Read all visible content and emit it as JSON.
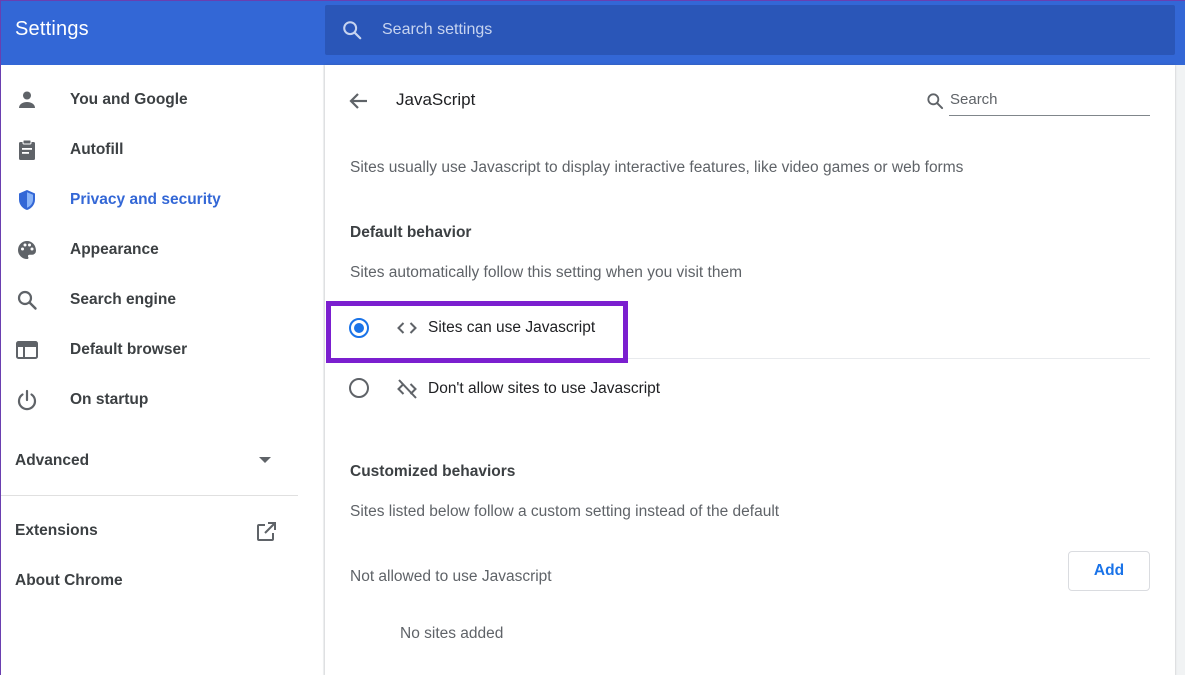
{
  "header": {
    "title": "Settings",
    "search_placeholder": "Search settings"
  },
  "sidebar": {
    "items": [
      {
        "label": "You and Google",
        "icon": "person-icon"
      },
      {
        "label": "Autofill",
        "icon": "clipboard-icon"
      },
      {
        "label": "Privacy and security",
        "icon": "shield-icon",
        "active": true
      },
      {
        "label": "Appearance",
        "icon": "palette-icon"
      },
      {
        "label": "Search engine",
        "icon": "search-icon"
      },
      {
        "label": "Default browser",
        "icon": "browser-icon"
      },
      {
        "label": "On startup",
        "icon": "power-icon"
      }
    ],
    "advanced_label": "Advanced",
    "extensions_label": "Extensions",
    "about_label": "About Chrome"
  },
  "page": {
    "title": "JavaScript",
    "search_placeholder": "Search",
    "description": "Sites usually use Javascript to display interactive features, like video games or web forms",
    "default_heading": "Default behavior",
    "default_desc": "Sites automatically follow this setting when you visit them",
    "options": [
      {
        "label": "Sites can use Javascript",
        "checked": true,
        "icon": "code-icon"
      },
      {
        "label": "Don't allow sites to use Javascript",
        "checked": false,
        "icon": "code-off-icon"
      }
    ],
    "custom_heading": "Customized behaviors",
    "custom_desc": "Sites listed below follow a custom setting instead of the default",
    "not_allowed_label": "Not allowed to use Javascript",
    "add_label": "Add",
    "no_sites_label": "No sites added"
  },
  "colors": {
    "header_bg": "#3367d6",
    "accent": "#1a73e8",
    "highlight_box": "#7b1fcf"
  }
}
